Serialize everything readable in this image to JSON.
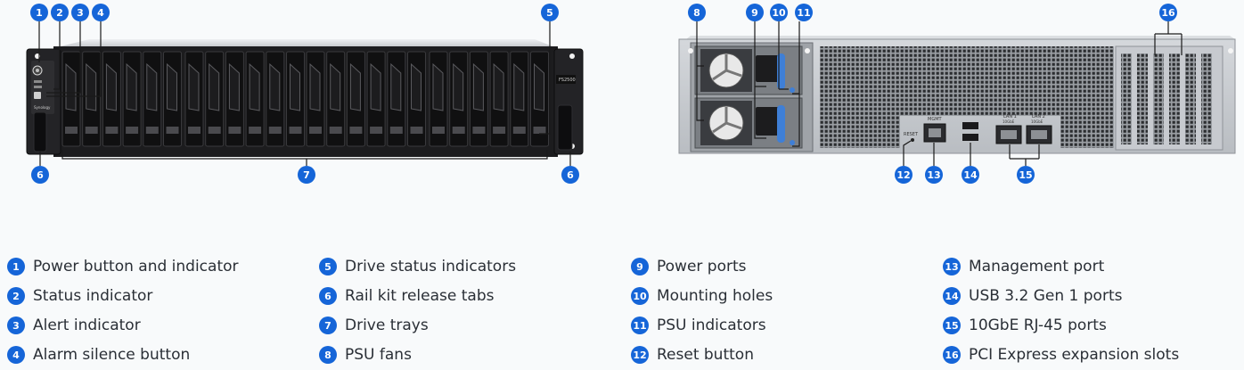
{
  "front": {
    "model_label": "FS2500",
    "brand_label": "Synology"
  },
  "rear": {
    "reset_label": "RESET",
    "mgmt_label": "MGMT",
    "lan1_label": "LAN 1",
    "lan2_label": "LAN 2",
    "lan_speed_label": "10GbE"
  },
  "colors": {
    "badge": "#1565d8",
    "psu_handle": "#3f7fd6",
    "chassis_dark": "#1b1b1d"
  },
  "legend": [
    {
      "num": "1",
      "label": "Power button and indicator"
    },
    {
      "num": "2",
      "label": "Status indicator"
    },
    {
      "num": "3",
      "label": "Alert indicator"
    },
    {
      "num": "4",
      "label": "Alarm silence button"
    },
    {
      "num": "5",
      "label": "Drive status indicators"
    },
    {
      "num": "6",
      "label": "Rail kit release tabs"
    },
    {
      "num": "7",
      "label": "Drive trays"
    },
    {
      "num": "8",
      "label": "PSU fans"
    },
    {
      "num": "9",
      "label": "Power ports"
    },
    {
      "num": "10",
      "label": "Mounting holes"
    },
    {
      "num": "11",
      "label": "PSU indicators"
    },
    {
      "num": "12",
      "label": "Reset button"
    },
    {
      "num": "13",
      "label": "Management port"
    },
    {
      "num": "14",
      "label": "USB 3.2 Gen 1 ports"
    },
    {
      "num": "15",
      "label": "10GbE RJ-45 ports"
    },
    {
      "num": "16",
      "label": "PCI Express expansion slots"
    }
  ],
  "callouts": [
    "1",
    "2",
    "3",
    "4",
    "5",
    "6",
    "6",
    "7",
    "8",
    "9",
    "10",
    "11",
    "12",
    "13",
    "14",
    "15",
    "16"
  ]
}
